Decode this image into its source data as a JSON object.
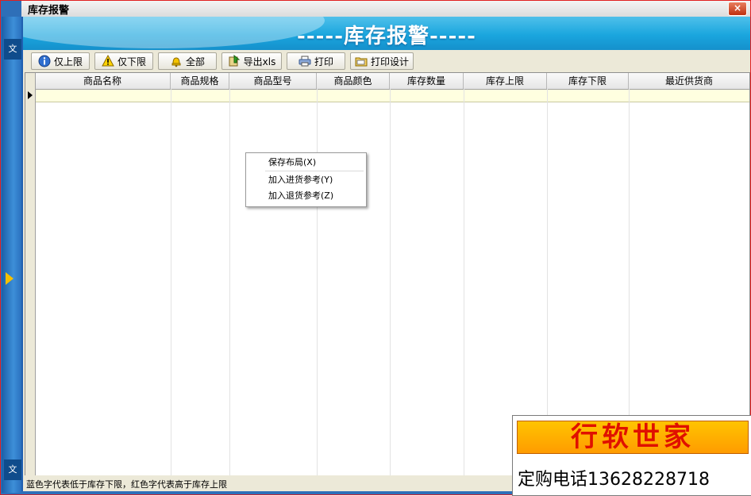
{
  "window": {
    "title": "库存报警",
    "close_glyph": "×"
  },
  "banner": {
    "title": "-----库存报警-----"
  },
  "left_strip": {
    "tab_top": "文",
    "tab_bottom": "文"
  },
  "toolbar": {
    "buttons": [
      {
        "label": "仅上限",
        "icon": "info-icon"
      },
      {
        "label": "仅下限",
        "icon": "warning-icon"
      },
      {
        "label": "全部",
        "icon": "bell-icon"
      },
      {
        "label": "导出xls",
        "icon": "export-icon"
      },
      {
        "label": "打印",
        "icon": "printer-icon"
      },
      {
        "label": "打印设计",
        "icon": "print-design-icon"
      }
    ]
  },
  "grid": {
    "columns": [
      "商品名称",
      "商品规格",
      "商品型号",
      "商品颜色",
      "库存数量",
      "库存上限",
      "库存下限",
      "最近供货商"
    ],
    "rows": []
  },
  "context_menu": {
    "items": [
      "保存布局(X)",
      "加入进货参考(Y)",
      "加入退货参考(Z)"
    ]
  },
  "status": {
    "text": "蓝色字代表低于库存下限，红色字代表高于库存上限"
  },
  "promo": {
    "brand": "行软世家",
    "phone": "定购电话13628228718"
  },
  "colors": {
    "banner": "#1aa6de",
    "accent_red": "#e01000",
    "window_bg": "#ece9d8",
    "selected_row": "#ffffe0"
  }
}
